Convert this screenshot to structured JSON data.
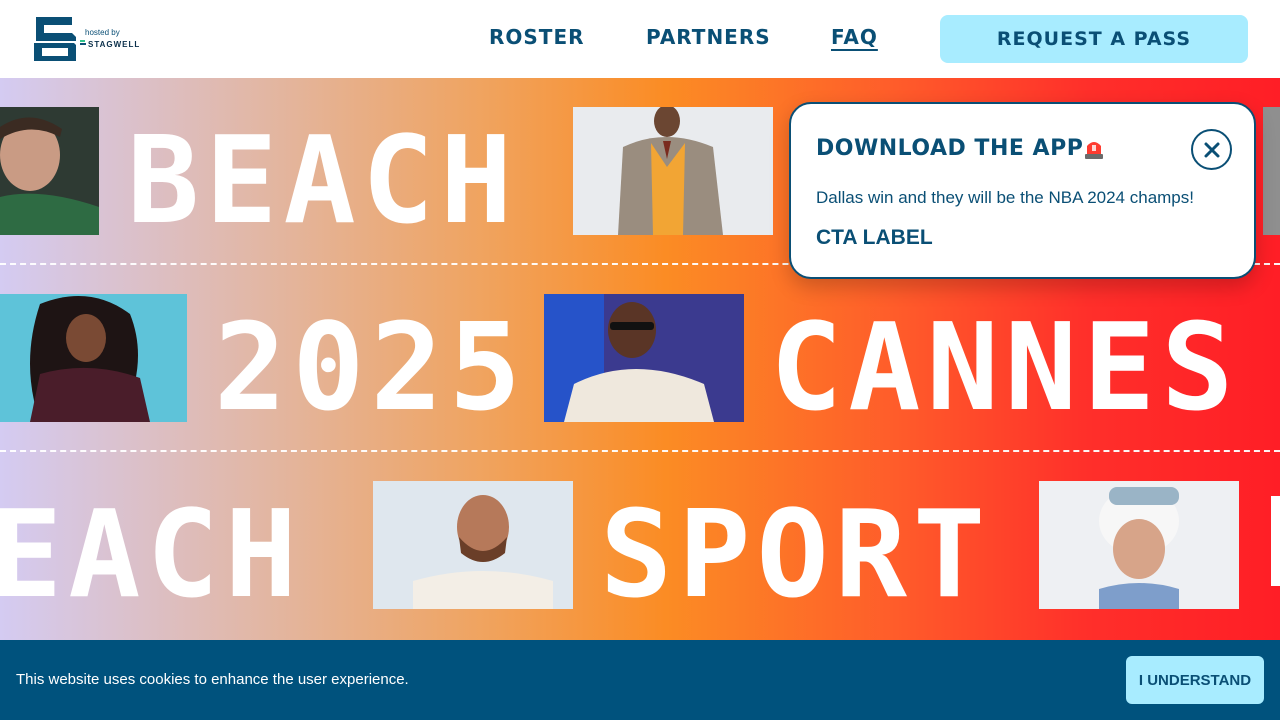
{
  "header": {
    "hosted_by": "hosted by",
    "partner_name": "STAGWELL",
    "nav": {
      "roster": "ROSTER",
      "partners": "PARTNERS",
      "faq": "FAQ"
    },
    "cta_label": "REQUEST A PASS"
  },
  "hero": {
    "row1_word": "BEACH",
    "row2_word1": "2025",
    "row2_word2": "CANNES",
    "row3_word1": "EACH",
    "row3_word2": "SPORT"
  },
  "popup": {
    "title": "DOWNLOAD THE APP",
    "body": "Dallas win and they will be the NBA 2024 champs!",
    "cta": "CTA LABEL"
  },
  "cookie": {
    "text": "This website uses cookies to enhance the user experience.",
    "button": "I UNDERSTAND"
  },
  "colors": {
    "brand_navy": "#0a4f75",
    "accent_cyan": "#a8ecff",
    "cookie_bg": "#00527d"
  }
}
